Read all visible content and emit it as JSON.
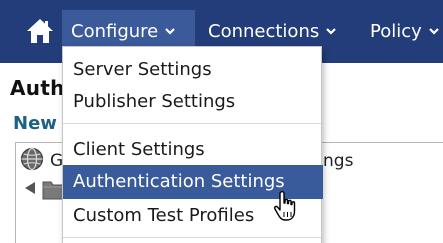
{
  "navbar": {
    "items": [
      {
        "label": "Configure",
        "has_caret": true,
        "active": true
      },
      {
        "label": "Connections",
        "has_caret": true,
        "active": false
      },
      {
        "label": "Policy",
        "has_caret": true,
        "active": false
      }
    ],
    "home_icon": "home-icon",
    "caret_icon": "chevron-down-icon"
  },
  "page": {
    "heading": "Auth",
    "link": "New",
    "tree": {
      "root_label": "G",
      "root_label_suffix": "ngs",
      "root_icon": "globe-icon",
      "child_icon": "folder-icon",
      "expander_icon": "triangle-icon"
    }
  },
  "dropdown": {
    "groups": [
      [
        {
          "label": "Server Settings",
          "highlighted": false
        },
        {
          "label": "Publisher Settings",
          "highlighted": false
        }
      ],
      [
        {
          "label": "Client Settings",
          "highlighted": false
        },
        {
          "label": "Authentication Settings",
          "highlighted": true
        },
        {
          "label": "Custom Test Profiles",
          "highlighted": false
        }
      ]
    ]
  },
  "colors": {
    "navbar_bg": "#223d79",
    "navbar_active_bg": "#3b5a9a",
    "menu_highlight_bg": "#3a5b9b",
    "link_color": "#1d6184"
  },
  "cursor_icon": "hand-pointer-icon"
}
